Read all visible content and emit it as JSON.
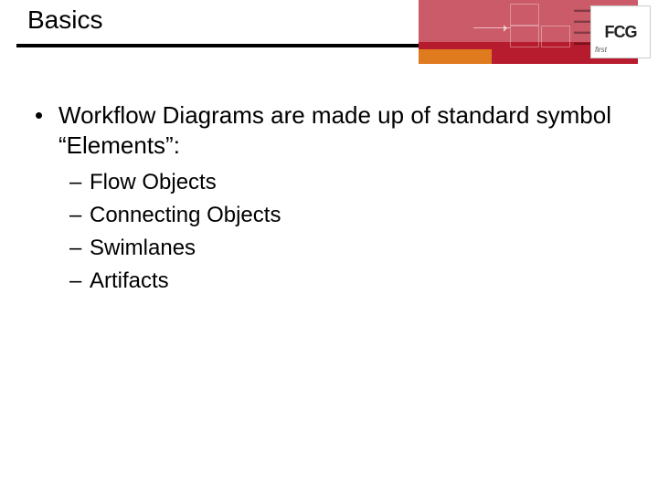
{
  "header": {
    "title": "Basics",
    "logo_big": "FCG",
    "logo_small": "first"
  },
  "content": {
    "main_bullet": "Workflow Diagrams are made up of standard symbol “Elements”:",
    "sub_bullets": [
      "Flow Objects",
      "Connecting Objects",
      "Swimlanes",
      "Artifacts"
    ]
  }
}
